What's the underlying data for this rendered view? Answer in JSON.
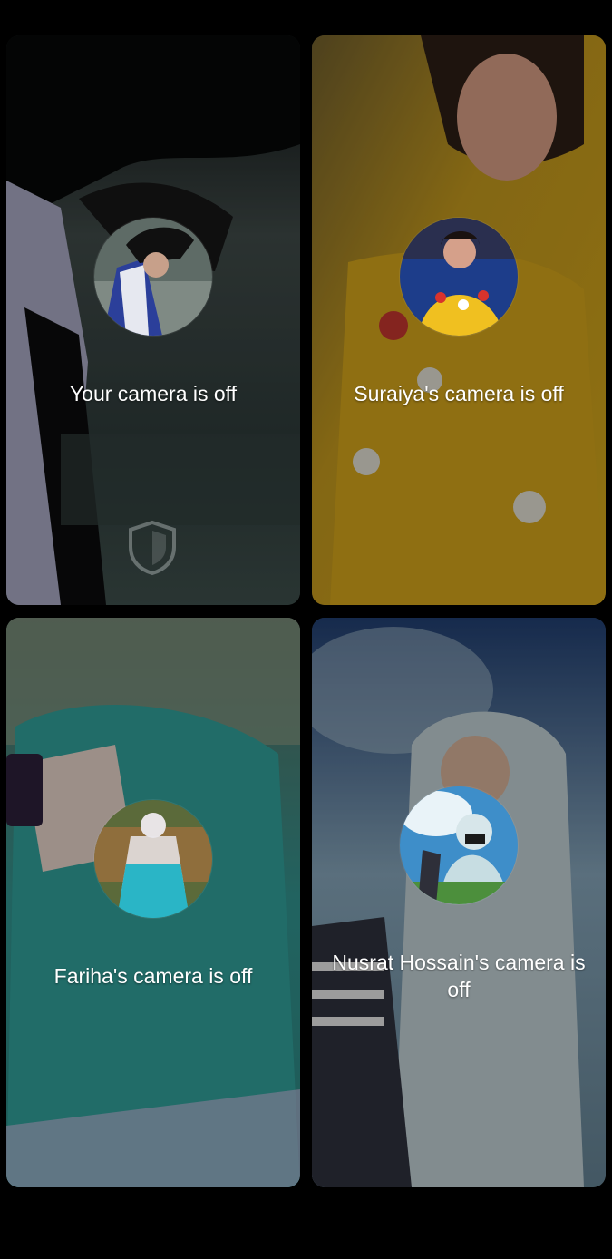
{
  "participants": [
    {
      "label": "Your camera is off",
      "colors": {
        "bg_a": "#3f4f4c",
        "bg_b": "#1b2325",
        "accent": "#c9c8e6"
      }
    },
    {
      "label": "Suraiya's camera is off",
      "colors": {
        "bg_a": "#c8a21f",
        "bg_b": "#6d5413",
        "accent": "#e84a3c"
      }
    },
    {
      "label": "Fariha's camera is off",
      "colors": {
        "bg_a": "#2f8f8a",
        "bg_b": "#3b4f44",
        "accent": "#e7e2e0"
      }
    },
    {
      "label": "Nusrat Hossain's camera is off",
      "colors": {
        "bg_a": "#6f8fa5",
        "bg_b": "#2f4a69",
        "accent": "#cfdde3"
      }
    }
  ],
  "icons": [
    "shield-icon"
  ]
}
